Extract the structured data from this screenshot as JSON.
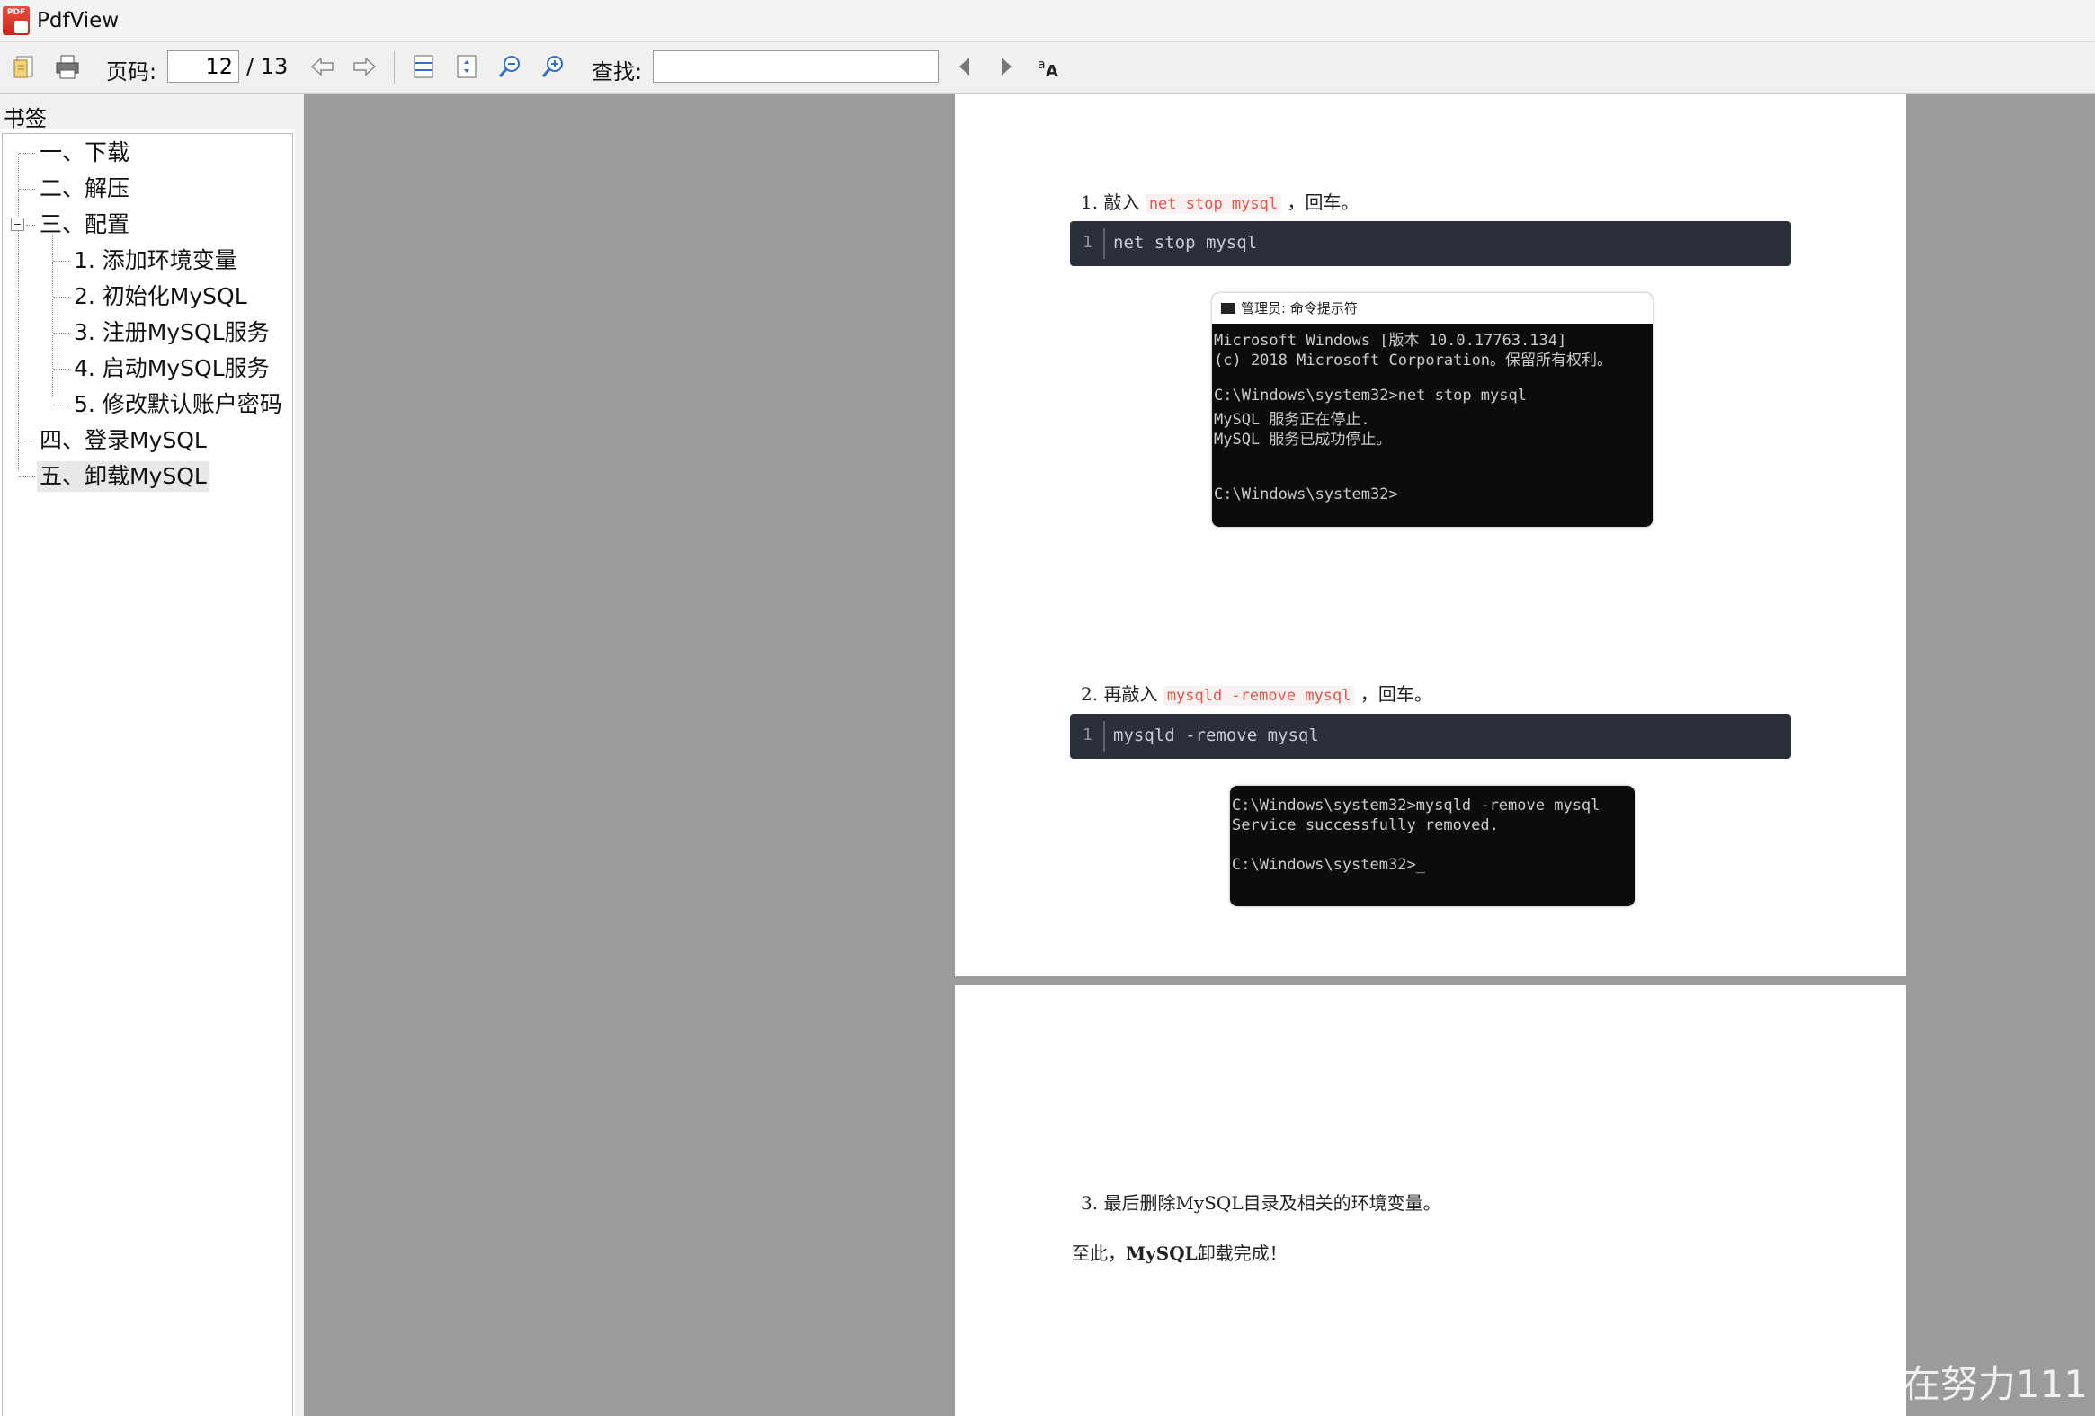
{
  "app": {
    "title": "PdfView"
  },
  "toolbar": {
    "page_label": "页码:",
    "page_value": "12",
    "page_total": "/ 13",
    "search_label": "查找:",
    "search_value": "",
    "icons": [
      "open-icon",
      "print-icon",
      "prev-page-icon",
      "next-page-icon",
      "fit-width-icon",
      "fit-page-icon",
      "zoom-out-icon",
      "zoom-in-icon",
      "find-prev-icon",
      "find-next-icon",
      "match-case-icon"
    ]
  },
  "sidebar": {
    "title": "书签",
    "items": [
      {
        "label": "一、下载"
      },
      {
        "label": "二、解压"
      },
      {
        "label": "三、配置"
      },
      {
        "label": "1. 添加环境变量"
      },
      {
        "label": "2. 初始化MySQL"
      },
      {
        "label": "3. 注册MySQL服务"
      },
      {
        "label": "4. 启动MySQL服务"
      },
      {
        "label": "5. 修改默认账户密码"
      },
      {
        "label": "四、登录MySQL"
      },
      {
        "label": "五、卸载MySQL"
      }
    ]
  },
  "document": {
    "step1": {
      "prefix": "1. 敲入",
      "code": "net stop mysql",
      "suffix": "，回车。",
      "block_line": "1",
      "block_code": "net stop mysql"
    },
    "term1": {
      "title": "管理员: 命令提示符",
      "lines": [
        "Microsoft Windows [版本 10.0.17763.134]",
        "(c) 2018 Microsoft Corporation。保留所有权利。",
        "",
        "C:\\Windows\\system32>net stop mysql",
        "MySQL 服务正在停止.",
        "MySQL 服务已成功停止。",
        "",
        "",
        "C:\\Windows\\system32>"
      ]
    },
    "step2": {
      "prefix": "2. 再敲入",
      "code": "mysqld -remove mysql",
      "suffix": "，回车。",
      "block_line": "1",
      "block_code": "mysqld -remove mysql"
    },
    "term2": {
      "lines": [
        "C:\\Windows\\system32>mysqld -remove mysql",
        "Service successfully removed.",
        "",
        "C:\\Windows\\system32>_"
      ]
    },
    "step3": "3. 最后删除MySQL目录及相关的环境变量。",
    "final": {
      "prefix": "至此，",
      "bold": "MySQL",
      "suffix": "卸载完成！"
    }
  },
  "watermark": "CSDN @小罗在努力111"
}
